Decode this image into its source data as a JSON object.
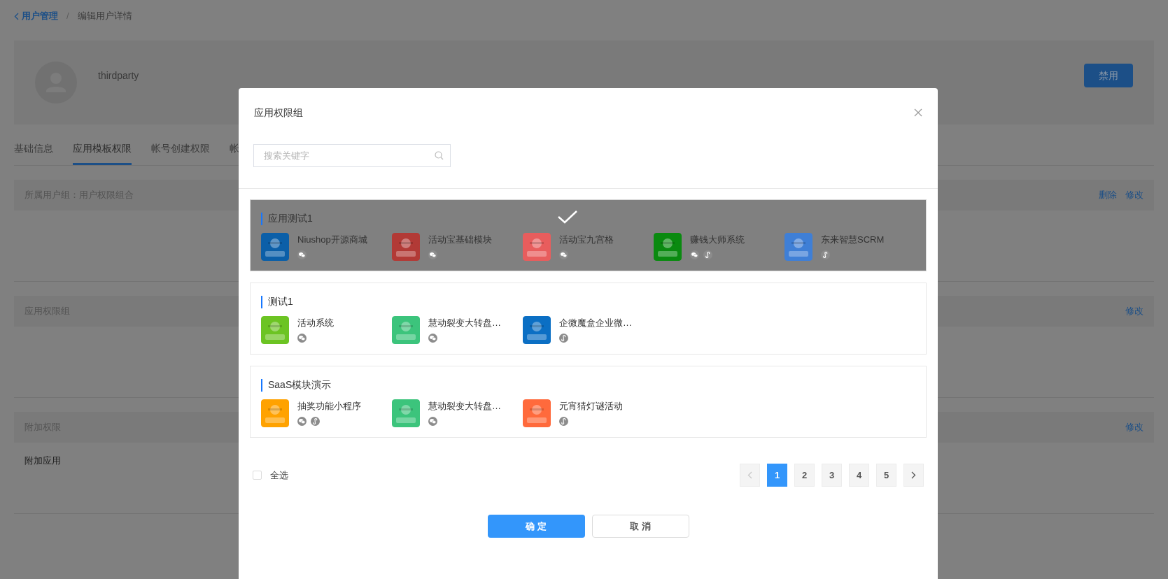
{
  "breadcrumb": {
    "back": "用户管理",
    "separator": "/",
    "current": "编辑用户详情"
  },
  "profile": {
    "username": "thirdparty",
    "disable_button": "禁用"
  },
  "tabs": [
    {
      "label": "基础信息",
      "selected": false
    },
    {
      "label": "应用模板权限",
      "selected": true
    },
    {
      "label": "帐号创建权限",
      "selected": false
    },
    {
      "label": "帐",
      "selected": false
    }
  ],
  "sections": [
    {
      "title": "所属用户组：用户权限组合",
      "actions": [
        "删除",
        "修改"
      ]
    },
    {
      "title": "应用权限组",
      "actions": [
        "修改"
      ]
    },
    {
      "title": "附加权限",
      "actions": [
        "修改"
      ],
      "subtitle": "附加应用"
    }
  ],
  "dialog": {
    "title": "应用权限组",
    "search": {
      "placeholder": "搜索关键字"
    },
    "groups": [
      {
        "title": "应用测试1",
        "selected": true,
        "apps": [
          {
            "name": "Niushop开源商城",
            "color": "#0b5fa8",
            "wechat": true,
            "mini_program": false
          },
          {
            "name": "活动宝基础模块",
            "color": "#b23a36",
            "wechat": true,
            "mini_program": false
          },
          {
            "name": "活动宝九宫格",
            "color": "#e85d5d",
            "wechat": true,
            "mini_program": false
          },
          {
            "name": "赚钱大师系统",
            "color": "#0a8a10",
            "wechat": true,
            "mini_program": true
          },
          {
            "name": "东来智慧SCRM",
            "color": "#3f7fd6",
            "wechat": false,
            "mini_program": true
          }
        ]
      },
      {
        "title": "测试1",
        "selected": false,
        "apps": [
          {
            "name": "活动系统",
            "color": "#6cc423",
            "wechat": true,
            "mini_program": false
          },
          {
            "name": "慧动裂变大转盘…",
            "color": "#3cc47c",
            "wechat": true,
            "mini_program": false
          },
          {
            "name": "企微魔盒企业微…",
            "color": "#0b6fc4",
            "wechat": false,
            "mini_program": true
          }
        ]
      },
      {
        "title": "SaaS模块演示",
        "selected": false,
        "apps": [
          {
            "name": "抽奖功能小程序",
            "color": "#ffa200",
            "wechat": true,
            "mini_program": true
          },
          {
            "name": "慧动裂变大转盘…",
            "color": "#3cc47c",
            "wechat": true,
            "mini_program": false
          },
          {
            "name": "元宵猜灯谜活动",
            "color": "#ff6a3c",
            "wechat": false,
            "mini_program": true
          }
        ]
      }
    ],
    "select_all": {
      "label": "全选",
      "checked": false
    },
    "pagination": {
      "prev_disabled": true,
      "next_disabled": false,
      "pages": [
        {
          "label": "1",
          "selected": true
        },
        {
          "label": "2",
          "selected": false
        },
        {
          "label": "3",
          "selected": false
        },
        {
          "label": "4",
          "selected": false
        },
        {
          "label": "5",
          "selected": false
        }
      ]
    },
    "buttons": {
      "ok": "确 定",
      "cancel": "取 消"
    }
  }
}
